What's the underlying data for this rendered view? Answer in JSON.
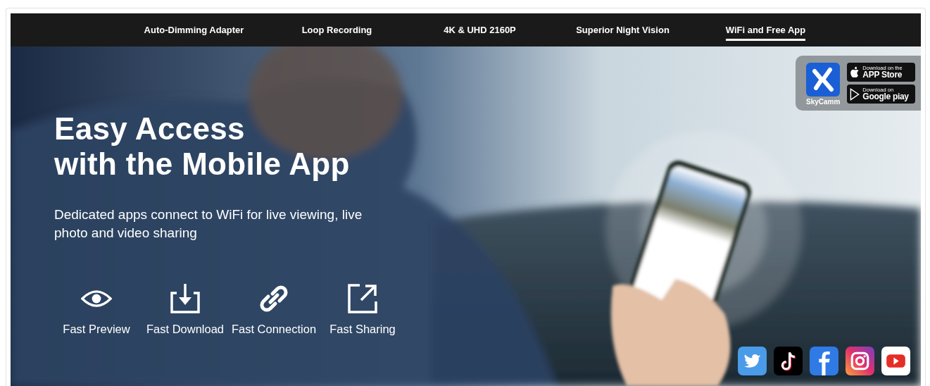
{
  "nav": {
    "tabs": [
      {
        "label": "Auto-Dimming Adapter",
        "selected": false
      },
      {
        "label": "Loop Recording",
        "selected": false
      },
      {
        "label": "4K & UHD 2160P",
        "selected": false
      },
      {
        "label": "Superior Night Vision",
        "selected": false
      },
      {
        "label": "WiFi and Free App",
        "selected": true
      }
    ]
  },
  "hero": {
    "kind": "picture",
    "title_lines": [
      "Easy Access",
      "with the Mobile App"
    ],
    "description": "Dedicated apps connect to WiFi for live viewing, live photo and video sharing",
    "features": [
      {
        "kind": "eye",
        "label": "Fast Preview"
      },
      {
        "kind": "download",
        "label": "Fast Download"
      },
      {
        "kind": "link",
        "label": "Fast Connection"
      },
      {
        "kind": "share",
        "label": "Fast Sharing"
      }
    ],
    "app": {
      "name": "SkyCamm",
      "stores": [
        {
          "kind": "apple",
          "line1": "Download on the",
          "line2": "APP Store"
        },
        {
          "kind": "google",
          "line1": "Download on",
          "line2": "Google piay"
        }
      ]
    },
    "social": [
      {
        "kind": "twitter"
      },
      {
        "kind": "tiktok"
      },
      {
        "kind": "facebook"
      },
      {
        "kind": "instagram"
      },
      {
        "kind": "youtube"
      }
    ]
  }
}
